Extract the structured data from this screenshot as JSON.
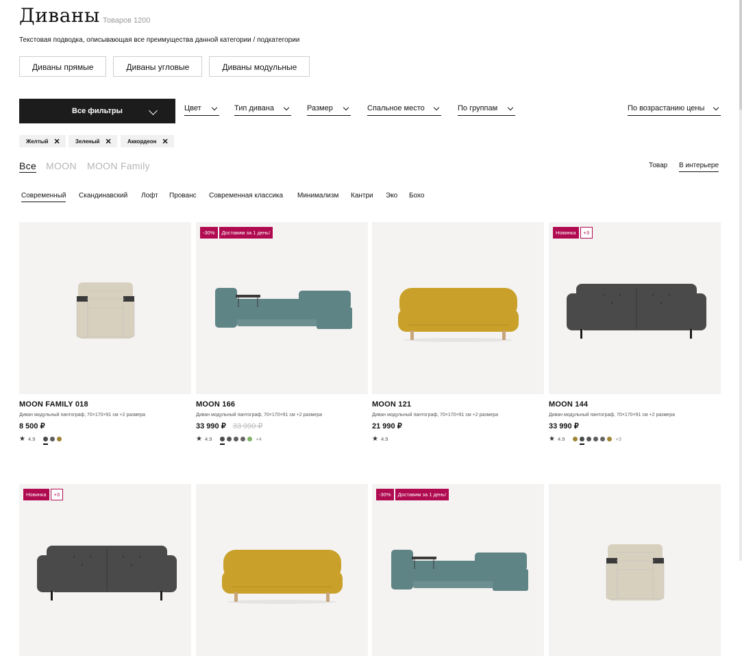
{
  "page": {
    "title": "Диваны",
    "count": "Товаров 1200",
    "subtitle": "Текстовая подводка, описывающая все преимущества данной категории / подкатегории"
  },
  "categories": [
    "Диваны прямые",
    "Диваны угловые",
    "Диваны модульные"
  ],
  "filters": {
    "all_label": "Все фильтры",
    "dropdowns": [
      "Цвет",
      "Тип дивана",
      "Размер",
      "Спальное место",
      "По группам"
    ],
    "sort": "По возрастанию цены"
  },
  "chips": [
    "Желтый",
    "Зеленый",
    "Аккордеон"
  ],
  "brand_tabs": [
    "Все",
    "MOON",
    "MOON Family"
  ],
  "view_tabs": [
    "Товар",
    "В интерьере"
  ],
  "style_tabs": [
    "Современный",
    "Скандинавский",
    "Лофт",
    "Прованс",
    "Современная классика",
    "Минимализм",
    "Кантри",
    "Эко",
    "Бохо"
  ],
  "products": [
    {
      "name": "MOON FAMILY 018",
      "desc": "Диван модульный пантограф, 70×170×91 см +2 размера",
      "price": "8 500 ₽",
      "old_price": "",
      "rating": "4.9",
      "swatches": [
        "#4a4a4a",
        "#5e5e5e",
        "#a08535"
      ],
      "selected_swatch": 0,
      "more": "",
      "badges": [],
      "sofa_color": "#d8d0bf"
    },
    {
      "name": "MOON 166",
      "desc": "Диван модульный пантограф, 70×170×91 см +2 размера",
      "price": "33 990 ₽",
      "old_price": "33 990 ₽",
      "rating": "4.9",
      "swatches": [
        "#4a4a4a",
        "#555555",
        "#5e5e5e",
        "#666666",
        "#7fb36a"
      ],
      "selected_swatch": 0,
      "more": "+4",
      "badges": [
        "-30%",
        "Доставим за 1 день!"
      ],
      "sofa_color": "#5f8486"
    },
    {
      "name": "MOON 121",
      "desc": "Диван модульный пантограф, 70×170×91 см +2 размера",
      "price": "21 990 ₽",
      "old_price": "",
      "rating": "4.9",
      "swatches": [],
      "selected_swatch": -1,
      "more": "",
      "badges": [],
      "sofa_color": "#c9a12a"
    },
    {
      "name": "MOON 144",
      "desc": "Диван модульный пантограф, 70×170×91 см +2 размера",
      "price": "33 990 ₽",
      "old_price": "",
      "rating": "4.9",
      "swatches": [
        "#a08535",
        "#4a4a4a",
        "#555555",
        "#5e5e5e",
        "#666666",
        "#a08535"
      ],
      "selected_swatch": 1,
      "more": "+3",
      "badges": [
        "Новинка",
        "+3"
      ],
      "sofa_color": "#4a4a4a"
    },
    {
      "name": "",
      "desc": "",
      "price": "",
      "old_price": "",
      "rating": "",
      "swatches": [],
      "selected_swatch": -1,
      "more": "",
      "badges": [
        "Новинка",
        "+3"
      ],
      "sofa_color": "#4a4a4a"
    },
    {
      "name": "",
      "desc": "",
      "price": "",
      "old_price": "",
      "rating": "",
      "swatches": [],
      "selected_swatch": -1,
      "more": "",
      "badges": [],
      "sofa_color": "#c9a12a"
    },
    {
      "name": "",
      "desc": "",
      "price": "",
      "old_price": "",
      "rating": "",
      "swatches": [],
      "selected_swatch": -1,
      "more": "",
      "badges": [
        "-30%",
        "Доставим за 1 день!"
      ],
      "sofa_color": "#5f8486"
    },
    {
      "name": "",
      "desc": "",
      "price": "",
      "old_price": "",
      "rating": "",
      "swatches": [],
      "selected_swatch": -1,
      "more": "",
      "badges": [],
      "sofa_color": "#d8d0bf"
    }
  ],
  "colors": {
    "accent": "#b00a50",
    "dark": "#1c1c1c"
  }
}
